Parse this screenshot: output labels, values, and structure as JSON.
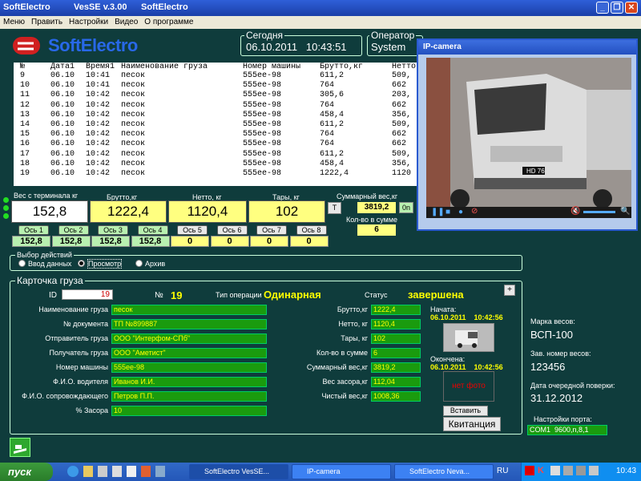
{
  "window": {
    "title_app": "SoftElectro",
    "title_ver": "VesSE v.3.00",
    "title_app2": "SoftElectro"
  },
  "menu": [
    "Меню",
    "Править",
    "Настройки",
    "Видео",
    "О программе"
  ],
  "logo": {
    "text": "SoftElectro"
  },
  "today": {
    "label": "Сегодня",
    "value": "06.10.2011   10:43:51"
  },
  "operator": {
    "label": "Оператор",
    "value": "System"
  },
  "table": {
    "headers": [
      "№",
      "Дата1",
      "Время1",
      "Наименование груза",
      "Номер машины",
      "Брутто,кг",
      "Нетто"
    ],
    "rows": [
      [
        "9",
        "06.10",
        "10:41",
        "песок",
        "555ee-98",
        "611,2",
        "509,"
      ],
      [
        "10",
        "06.10",
        "10:41",
        "песок",
        "555ee-98",
        "764",
        "662"
      ],
      [
        "11",
        "06.10",
        "10:42",
        "песок",
        "555ee-98",
        "305,6",
        "203,"
      ],
      [
        "12",
        "06.10",
        "10:42",
        "песок",
        "555ee-98",
        "764",
        "662"
      ],
      [
        "13",
        "06.10",
        "10:42",
        "песок",
        "555ee-98",
        "458,4",
        "356,"
      ],
      [
        "14",
        "06.10",
        "10:42",
        "песок",
        "555ee-98",
        "611,2",
        "509,"
      ],
      [
        "15",
        "06.10",
        "10:42",
        "песок",
        "555ee-98",
        "764",
        "662"
      ],
      [
        "16",
        "06.10",
        "10:42",
        "песок",
        "555ee-98",
        "764",
        "662"
      ],
      [
        "17",
        "06.10",
        "10:42",
        "песок",
        "555ee-98",
        "611,2",
        "509,"
      ],
      [
        "18",
        "06.10",
        "10:42",
        "песок",
        "555ee-98",
        "458,4",
        "356,"
      ],
      [
        "19",
        "06.10",
        "10:42",
        "песок",
        "555ee-98",
        "1222,4",
        "1120"
      ]
    ]
  },
  "weights": {
    "terminal_label": "Вес с терминала  кг",
    "terminal_value": "152,8",
    "brutto_label": "Брутто,кг",
    "brutto_value": "1222,4",
    "netto_label": "Нетто, кг",
    "netto_value": "1120,4",
    "tara_label": "Тары, кг",
    "tara_value": "102",
    "t_button": "T",
    "sum_label": "Суммарный вес,кг",
    "sum_value": "3819,2",
    "on_button": "0n",
    "count_label": "Кол-во в сумме",
    "count_value": "6"
  },
  "axes": [
    {
      "label": "Ось 1",
      "value": "152,8"
    },
    {
      "label": "Ось 2",
      "value": "152,8"
    },
    {
      "label": "Ось 3",
      "value": "152,8"
    },
    {
      "label": "Ось 4",
      "value": "152,8"
    },
    {
      "label": "Ось 5",
      "value": "0"
    },
    {
      "label": "Ось 6",
      "value": "0"
    },
    {
      "label": "Ось 7",
      "value": "0"
    },
    {
      "label": "Ось 8",
      "value": "0"
    }
  ],
  "actions": {
    "title": "Выбор действий",
    "options": [
      "Ввод данных",
      "Просмотр",
      "Архив"
    ]
  },
  "card": {
    "title": "Карточка груза",
    "id_label": "ID",
    "id_value": "19",
    "num_label": "№",
    "num_value": "19",
    "optype_label": "Тип операции",
    "optype_value": "Одинарная",
    "status_label": "Статус",
    "status_value": "завершена",
    "plus": "+",
    "left_fields": [
      {
        "label": "Наименование груза",
        "value": "песок"
      },
      {
        "label": "№ документа",
        "value": "ТП №899887"
      },
      {
        "label": "Отправитель груза",
        "value": "ООО \"Интерфом-СПб\""
      },
      {
        "label": "Получатель груза",
        "value": "ООО \"Аметист\""
      },
      {
        "label": "Номер машины",
        "value": "555ee-98"
      },
      {
        "label": "Ф.И.О. водителя",
        "value": "Иванов И.И."
      },
      {
        "label": "Ф.И.О. сопровождающего",
        "value": "Петров П.П."
      },
      {
        "label": "% Засора",
        "value": "10"
      }
    ],
    "right_fields": [
      {
        "label": "Брутто,кг",
        "value": "1222,4"
      },
      {
        "label": "Нетто, кг",
        "value": "1120,4"
      },
      {
        "label": "Тары, кг",
        "value": "102"
      },
      {
        "label": "Кол-во в сумме",
        "value": "6"
      },
      {
        "label": "Суммарный вес,кг",
        "value": "3819,2"
      },
      {
        "label": "Вес засора,кг",
        "value": "112,04"
      },
      {
        "label": "Чистый вес,кг",
        "value": "1008,36"
      }
    ],
    "start_label": "Начата:",
    "start_value": "06.10.2011    10:42:56",
    "end_label": "Окончена:",
    "end_value": "06.10.2011    10:42:56",
    "no_photo": "нет фото",
    "insert_button": "Вставить",
    "receipt_button": "Квитанция"
  },
  "scale_info": {
    "brand_label": "Марка весов:",
    "brand_value": "ВСП-100",
    "serial_label": "Зав. номер весов:",
    "serial_value": "123456",
    "check_label": "Дата очередной поверки:",
    "check_value": "31.12.2012",
    "port_label": "Настройки порта:",
    "port_value": "COM1  9600,n,8,1"
  },
  "camera": {
    "title": "IP-camera",
    "truck_plate": "HD 76"
  },
  "taskbar": {
    "start": "пуск",
    "items": [
      "SoftElectro      VesSE...",
      "IP-camera",
      "SoftElectro      Neva..."
    ],
    "lang": "RU",
    "clock": "10:43"
  },
  "colors": {
    "accent_yellow": "#ffff80",
    "field_green": "#1a9b0e",
    "bg": "#0f3c3c",
    "title_blue": "#2868e8"
  }
}
